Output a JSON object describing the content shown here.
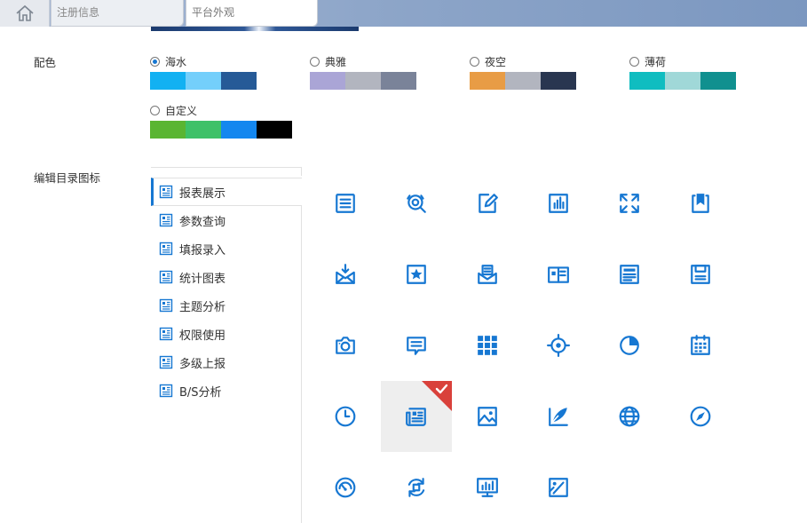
{
  "tabs": [
    {
      "label": "注册信息"
    },
    {
      "label": "平台外观"
    }
  ],
  "color_section": {
    "label": "配色",
    "palettes": [
      {
        "name": "海水",
        "selected": true,
        "colors": [
          "#12b1f2",
          "#74cffb",
          "#265a97",
          "#ffffff"
        ]
      },
      {
        "name": "典雅",
        "selected": false,
        "colors": [
          "#aaa5d6",
          "#b2b5bf",
          "#7a8399",
          "#ffffff"
        ]
      },
      {
        "name": "夜空",
        "selected": false,
        "colors": [
          "#e89c45",
          "#b2b5bf",
          "#293650",
          "#ffffff"
        ]
      },
      {
        "name": "薄荷",
        "selected": false,
        "colors": [
          "#0fbdc0",
          "#a0d8d8",
          "#10908f",
          "#ffffff"
        ]
      },
      {
        "name": "自定义",
        "selected": false,
        "colors": [
          "#5ab532",
          "#3ec168",
          "#1487ef",
          "#000000"
        ]
      }
    ]
  },
  "icon_section": {
    "label": "编辑目录图标",
    "directory_items": [
      {
        "label": "报表展示"
      },
      {
        "label": "参数查询"
      },
      {
        "label": "填报录入"
      },
      {
        "label": "统计图表"
      },
      {
        "label": "主题分析"
      },
      {
        "label": "权限使用"
      },
      {
        "label": "多级上报"
      },
      {
        "label": "B/S分析"
      }
    ],
    "icons": [
      "list-document-icon",
      "search-analyze-icon",
      "edit-pencil-icon",
      "bar-chart-icon",
      "fullscreen-expand-icon",
      "clipboard-copy-icon",
      "mail-download-icon",
      "star-card-icon",
      "envelope-letter-icon",
      "book-open-icon",
      "news-document-icon",
      "floppy-save-icon",
      "camera-icon",
      "message-list-icon",
      "grid-apps-icon",
      "target-locate-icon",
      "pie-chart-icon",
      "calendar-icon",
      "clock-icon",
      "newspaper-icon",
      "image-picture-icon",
      "feather-write-icon",
      "globe-icon",
      "compass-icon",
      "speedometer-icon",
      "refresh-sync-icon",
      "monitor-chart-icon",
      "image-edit-icon"
    ],
    "selected_icon": "newspaper-icon",
    "icon_color": "#1677d2",
    "check_color": "#d9413b"
  }
}
